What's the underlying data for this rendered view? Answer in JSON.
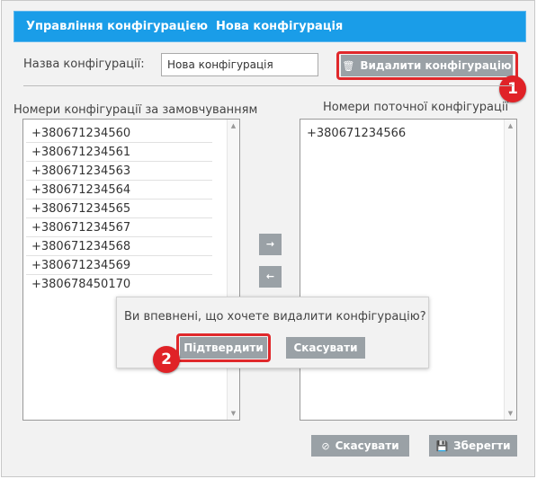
{
  "header": {
    "title": "Управління конфігурацією  Нова конфігурація"
  },
  "config": {
    "name_label": "Назва конфігурації:",
    "name_value": "Нова конфігурація"
  },
  "delete_button": {
    "label": "Видалити конфігурацію",
    "icon": "trash-icon",
    "badge": "1"
  },
  "default_list": {
    "title": "Номери конфігурації за замовчуванням",
    "items": [
      "+380671234560",
      "+380671234561",
      "+380671234563",
      "+380671234564",
      "+380671234565",
      "+380671234567",
      "+380671234568",
      "+380671234569",
      "+380678450170"
    ]
  },
  "current_list": {
    "title": "Номери поточної конфігурації",
    "items": [
      "+380671234566"
    ]
  },
  "move_buttons": {
    "right": "→",
    "left": "←"
  },
  "dialog": {
    "message": "Ви впевнені, що хочете видалити конфігурацію?",
    "confirm_label": "Підтвердити",
    "cancel_label": "Скасувати",
    "badge": "2"
  },
  "footer": {
    "cancel_label": "Скасувати",
    "save_label": "Зберегти",
    "cancel_icon": "cancel-circle-icon",
    "save_icon": "floppy-disk-icon"
  },
  "colors": {
    "header_bg": "#1a9de8",
    "button_bg": "#9aa1a6",
    "highlight": "#e0282b"
  }
}
